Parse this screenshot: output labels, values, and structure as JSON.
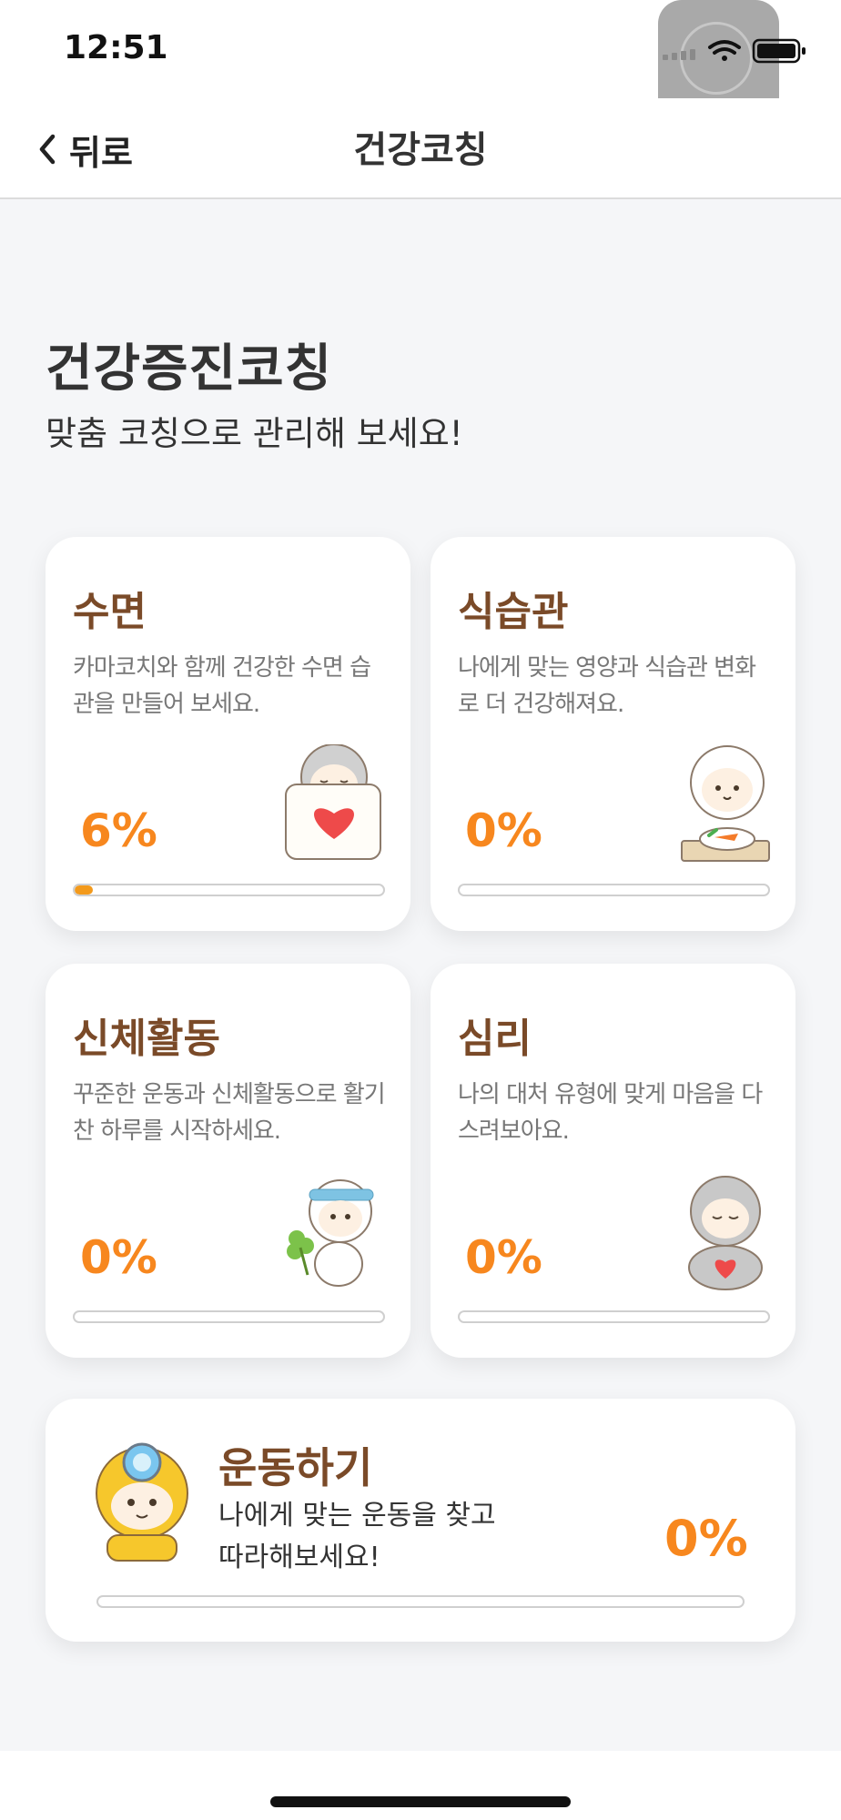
{
  "status_bar": {
    "time": "12:51"
  },
  "nav": {
    "back_label": "뒤로",
    "title": "건강코칭"
  },
  "hero": {
    "title": "건강증진코칭",
    "subtitle": "맞춤 코칭으로 관리해 보세요!"
  },
  "cards": [
    {
      "title": "수면",
      "description": "카마코치와 함께 건강한 수면 습관을 만들어 보세요.",
      "percent": "6%",
      "progress": 0.06
    },
    {
      "title": "식습관",
      "description": "나에게 맞는 영양과 식습관 변화로 더 건강해져요.",
      "percent": "0%",
      "progress": 0
    },
    {
      "title": "신체활동",
      "description": "꾸준한 운동과 신체활동으로 활기찬 하루를 시작하세요.",
      "percent": "0%",
      "progress": 0
    },
    {
      "title": "심리",
      "description": "나의 대처 유형에 맞게 마음을 다스려보아요.",
      "percent": "0%",
      "progress": 0
    }
  ],
  "exercise": {
    "title": "운동하기",
    "description": "나에게 맞는 운동을 찾고 따라해보세요!",
    "percent": "0%",
    "progress": 0
  },
  "colors": {
    "accent": "#f7871e",
    "title_brown": "#7a4a28",
    "progress_fill": "#f39a1c",
    "background": "#f5f6f8"
  },
  "icons": [
    "chevron-left-icon",
    "cellular-signal-icon",
    "wifi-icon",
    "battery-icon",
    "assistive-touch-icon"
  ]
}
